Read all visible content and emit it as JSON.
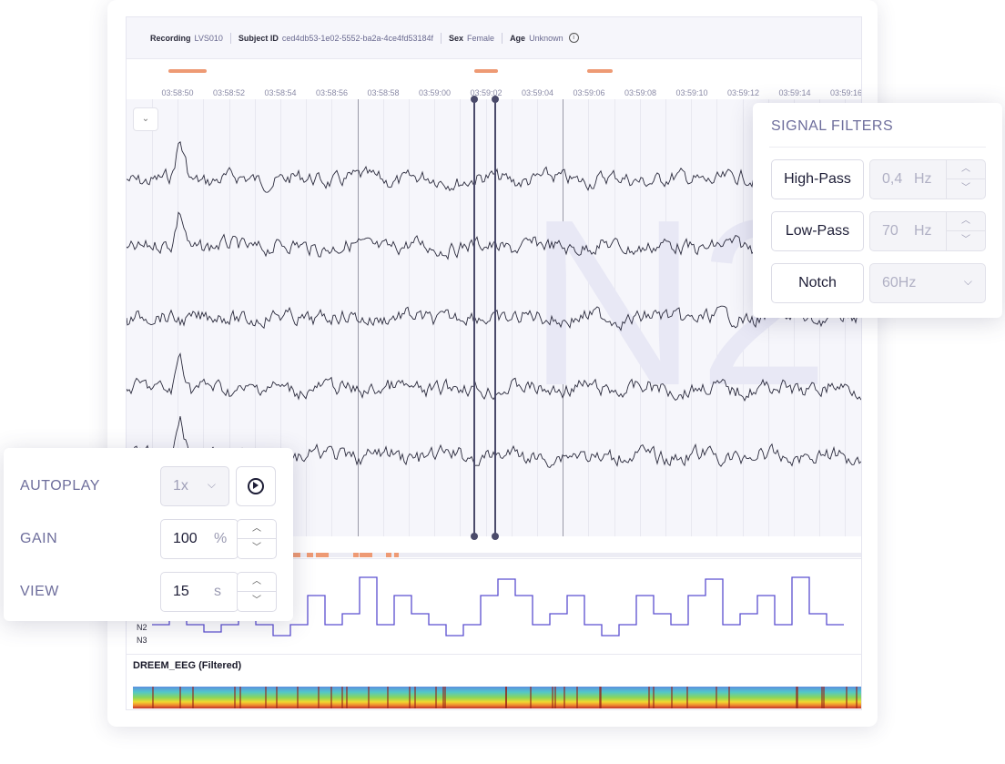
{
  "header": {
    "recording_label": "Recording",
    "recording_value": "LVS010",
    "subject_label": "Subject ID",
    "subject_value": "ced4db53-1e02-5552-ba2a-4ce4fd53184f",
    "sex_label": "Sex",
    "sex_value": "Female",
    "age_label": "Age",
    "age_value": "Unknown",
    "info_icon": "i"
  },
  "timeline": {
    "ticks": [
      "03:58:50",
      "03:58:52",
      "03:58:54",
      "03:58:56",
      "03:58:58",
      "03:59:00",
      "03:59:02",
      "03:59:04",
      "03:59:06",
      "03:59:08",
      "03:59:10",
      "03:59:12",
      "03:59:14",
      "03:59:16"
    ]
  },
  "chart": {
    "stage_watermark": "N2",
    "dropdown_icon": "chevron-down-icon",
    "dropdown_glyph": "⌄"
  },
  "hypnogram": {
    "stage_labels": [
      "N2",
      "N3"
    ]
  },
  "spectrogram": {
    "title": "DREEM_EEG (Filtered)"
  },
  "signal_filters": {
    "title": "SIGNAL FILTERS",
    "high_pass": {
      "label": "High-Pass",
      "value": "0,4",
      "unit": "Hz"
    },
    "low_pass": {
      "label": "Low-Pass",
      "value": "70",
      "unit": "Hz"
    },
    "notch": {
      "label": "Notch",
      "value": "60Hz"
    }
  },
  "controls": {
    "autoplay": {
      "label": "AUTOPLAY",
      "speed": "1x"
    },
    "gain": {
      "label": "GAIN",
      "value": "100",
      "unit": "%"
    },
    "view": {
      "label": "VIEW",
      "value": "15",
      "unit": "s"
    }
  },
  "glyphs": {
    "up": "︿",
    "down": "﹀",
    "chevron_down": "⌵"
  },
  "colors": {
    "accent": "#6e6e9c",
    "marker": "#ee9a74",
    "hypnogram_line": "#5b4fd0"
  }
}
